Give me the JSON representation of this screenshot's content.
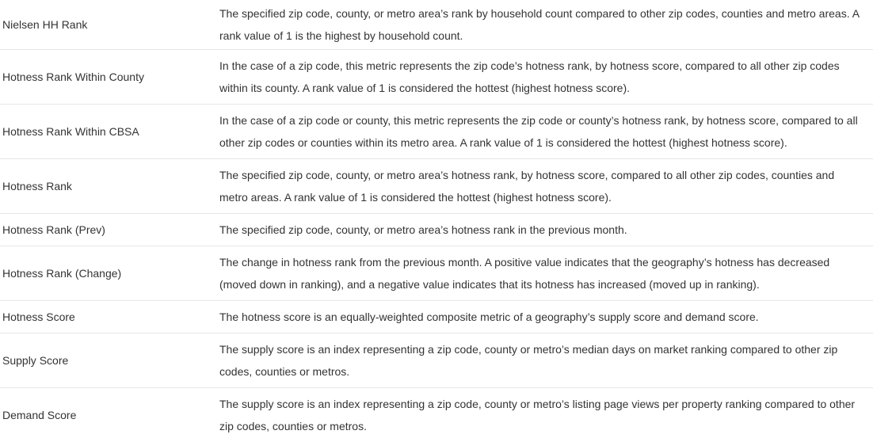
{
  "rows": [
    {
      "term": "Nielsen HH Rank",
      "description": "The specified zip code, county, or metro area’s rank by household count compared to other zip codes, counties and metro areas. A rank value of 1 is the highest by household count."
    },
    {
      "term": "Hotness Rank Within County",
      "description": "In the case of a zip code, this metric represents the zip code’s hotness rank, by hotness score, compared to all other zip codes within its county. A rank value of 1 is considered the hottest (highest hotness score)."
    },
    {
      "term": "Hotness Rank Within CBSA",
      "description": "In the case of a zip code or county, this metric represents the zip code or county’s hotness rank, by hotness score, compared to all other zip codes or counties within its metro area. A rank value of 1 is considered the hottest (highest hotness score)."
    },
    {
      "term": "Hotness Rank",
      "description": "The specified zip code, county, or metro area’s hotness rank, by hotness score, compared to all other zip codes, counties and metro areas. A rank value of 1 is considered the hottest (highest hotness score)."
    },
    {
      "term": "Hotness Rank (Prev)",
      "description": "The specified zip code, county, or metro area’s hotness rank in the previous month."
    },
    {
      "term": "Hotness Rank (Change)",
      "description": "The change in hotness rank from the previous month. A positive value indicates that the geography’s hotness has decreased (moved down in ranking), and a negative value indicates that its hotness has increased (moved up in ranking)."
    },
    {
      "term": "Hotness Score",
      "description": "The hotness score is an equally-weighted composite metric of a geography’s supply score and demand score."
    },
    {
      "term": "Supply Score",
      "description": "The supply score is an index representing a zip code, county or metro’s median days on market ranking compared to other zip codes, counties or metros."
    },
    {
      "term": "Demand Score",
      "description": "The supply score is an index representing a zip code, county or metro’s listing page views per property ranking compared to other zip codes, counties or metros."
    }
  ]
}
